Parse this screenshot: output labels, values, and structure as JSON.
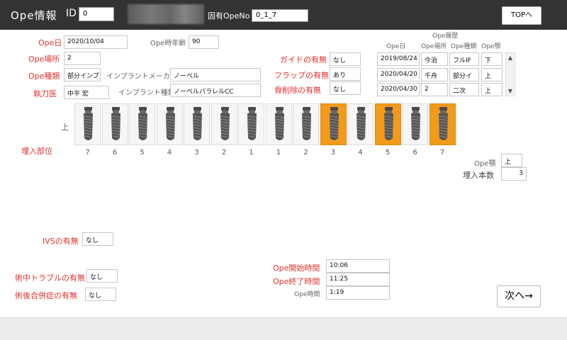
{
  "header": {
    "title": "Ope情報",
    "id_label": "ID",
    "id_value": "0",
    "unique_label": "固有OpeNo",
    "unique_value": "0_1_7",
    "top_button": "TOPへ"
  },
  "form": {
    "ope_date_label": "Ope日",
    "ope_date": "2020/10/04",
    "age_label": "Ope時年齢",
    "age": "90",
    "place_label": "Ope場所",
    "place": "2",
    "type_label": "Ope種類",
    "type": "部分インプ",
    "maker_label": "インプラントメーカー",
    "maker": "ノーベル",
    "surgeon_label": "執刀医",
    "surgeon": "中平 宏",
    "implant_type_label": "インプラント種類",
    "implant_type": "ノーベルパラレルCC",
    "guide_label": "ガイドの有無",
    "guide": "なし",
    "flap_label": "フラップの有無",
    "flap": "あり",
    "bone_label": "骨削除の有無",
    "bone": "なし"
  },
  "history": {
    "title": "Ope履歴",
    "columns": [
      "Ope日",
      "Ope場所",
      "Ope種類",
      "Ope顎"
    ],
    "rows": [
      [
        "2019/08/24",
        "今治",
        "フルIF",
        "下"
      ],
      [
        "2020/04/20",
        "千舟",
        "部分イ",
        "上"
      ],
      [
        "2020/04/30",
        "2",
        "二次",
        "上"
      ]
    ]
  },
  "chart": {
    "jaw_label": "上",
    "site_label": "埋入部位",
    "teeth": [
      "7",
      "6",
      "5",
      "4",
      "3",
      "2",
      "1",
      "1",
      "2",
      "3",
      "4",
      "5",
      "6",
      "7"
    ],
    "selected": [
      false,
      false,
      false,
      false,
      false,
      false,
      false,
      false,
      false,
      true,
      false,
      true,
      false,
      true
    ],
    "selected_color": "#f39a1a",
    "jaw_field_label": "Ope顎",
    "jaw_value": "上",
    "count_label": "埋入本数",
    "count_value": "3"
  },
  "bottom": {
    "ivs_label": "IVSの有無",
    "ivs": "なし",
    "intra_label": "術中トラブルの有無",
    "intra": "なし",
    "post_label": "術後合併症の有無",
    "post": "なし",
    "start_label": "Ope開始時間",
    "start": "10:06",
    "end_label": "Ope終了時間",
    "end": "11:25",
    "duration_label": "Ope時間",
    "duration": "1:19",
    "next_button": "次へ→"
  }
}
